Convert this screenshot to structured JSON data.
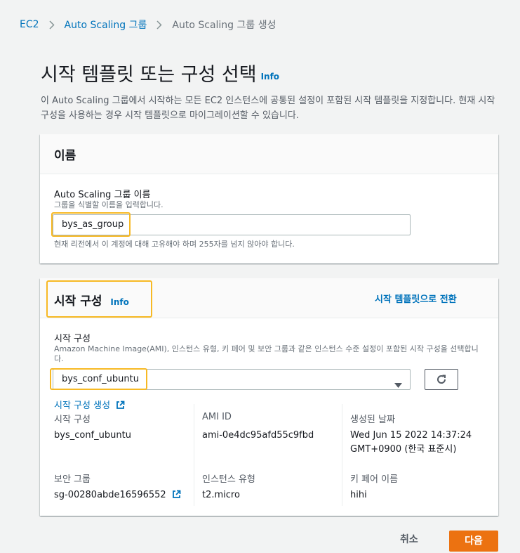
{
  "breadcrumb": {
    "items": [
      "EC2",
      "Auto Scaling 그룹",
      "Auto Scaling 그룹 생성"
    ]
  },
  "page": {
    "title": "시작 템플릿 또는 구성 선택",
    "info": "Info",
    "description": "이 Auto Scaling 그룹에서 시작하는 모든 EC2 인스턴스에 공통된 설정이 포함된 시작 템플릿을 지정합니다. 현재 시작 구성을 사용하는 경우 시작 템플릿으로 마이그레이션할 수 있습니다."
  },
  "name_panel": {
    "title": "이름",
    "label": "Auto Scaling 그룹 이름",
    "description": "그룹을 식별할 이름을 입력합니다.",
    "value": "bys_as_group",
    "constraint": "현재 리전에서 이 계정에 대해 고유해야 하며 255자를 넘지 않아야 합니다."
  },
  "config_panel": {
    "title": "시작 구성",
    "info": "Info",
    "switch_link": "시작 템플릿으로 전환",
    "label": "시작 구성",
    "description": "Amazon Machine Image(AMI), 인스턴스 유형, 키 페어 및 보안 그룹과 같은 인스턴스 수준 설정이 포함된 시작 구성을 선택합니다.",
    "selected": "bys_conf_ubuntu",
    "create_link": "시작 구성 생성",
    "details": {
      "launch_config_label": "시작 구성",
      "launch_config_value": "bys_conf_ubuntu",
      "ami_label": "AMI ID",
      "ami_value": "ami-0e4dc95afd55c9fbd",
      "date_label": "생성된 날짜",
      "date_value_1": "Wed Jun 15 2022 14:37:24",
      "date_value_2": "GMT+0900 (한국 표준시)",
      "sg_label": "보안 그룹",
      "sg_value": "sg-00280abde16596552",
      "instance_label": "인스턴스 유형",
      "instance_value": "t2.micro",
      "key_label": "키 페어 이름",
      "key_value": "hihi"
    }
  },
  "footer": {
    "cancel": "취소",
    "next": "다음"
  },
  "colors": {
    "accent": "#0073bb",
    "primary_button": "#ec7211",
    "highlight": "#f7b924"
  }
}
